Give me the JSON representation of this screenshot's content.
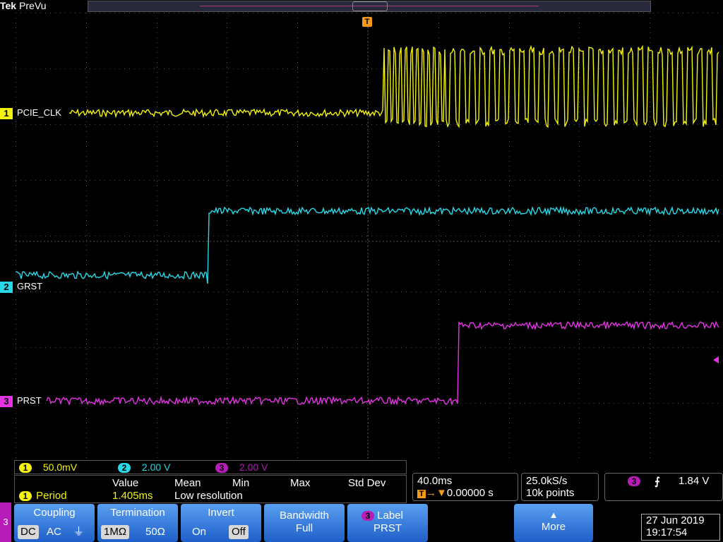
{
  "header": {
    "brand": "Tek",
    "mode": "PreVu"
  },
  "trigger_marker": "T",
  "colors": {
    "ch1": "#f2f20a",
    "ch2": "#27d8e8",
    "ch3": "#e433e4",
    "accent": "#f39a1a",
    "button": "#2f7ae0"
  },
  "channels": [
    {
      "num": "1",
      "label": "PCIE_CLK"
    },
    {
      "num": "2",
      "label": "GRST"
    },
    {
      "num": "3",
      "label": "PRST"
    }
  ],
  "readouts": {
    "ch1": {
      "num": "1",
      "scale": "50.0mV"
    },
    "ch2": {
      "num": "2",
      "scale": "2.00 V"
    },
    "ch3": {
      "num": "3",
      "scale": "2.00 V"
    }
  },
  "measurement": {
    "chan": "1",
    "name": "Period",
    "headers": [
      "Value",
      "Mean",
      "Min",
      "Max",
      "Std Dev"
    ],
    "value": "1.405ms",
    "note": "Low resolution"
  },
  "horizontal": {
    "scale": "40.0ms",
    "position": "0.00000 s"
  },
  "acquisition": {
    "rate": "25.0kS/s",
    "points": "10k points"
  },
  "trigger": {
    "source": "3",
    "slope": "✠",
    "level": "1.84 V"
  },
  "menu": {
    "channel_tab": "3",
    "coupling": {
      "title": "Coupling",
      "opts": [
        "DC",
        "AC",
        "⏚"
      ]
    },
    "termination": {
      "title": "Termination",
      "opts": [
        "1MΩ",
        "50Ω"
      ]
    },
    "invert": {
      "title": "Invert",
      "opts": [
        "On",
        "Off"
      ]
    },
    "bandwidth": {
      "title": "Bandwidth",
      "value": "Full"
    },
    "label": {
      "chan": "3",
      "title": "Label",
      "value": "PRST"
    },
    "more": {
      "title": "More"
    }
  },
  "datetime": {
    "date": "27 Jun 2019",
    "time": "19:17:54"
  }
}
